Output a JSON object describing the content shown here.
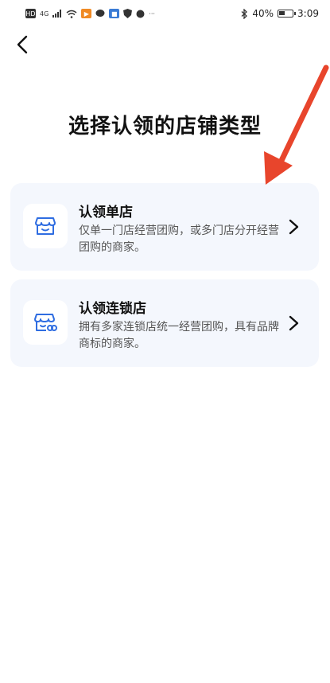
{
  "status_bar": {
    "network_label": "4G",
    "battery_percent": "40%",
    "time": "3:09",
    "more_indicator": "···",
    "icons": [
      "hd-icon",
      "signal-icon",
      "wifi-icon",
      "app-notification-icon",
      "chat-icon",
      "app-icon",
      "shield-icon",
      "bluetooth-icon",
      "battery-icon"
    ]
  },
  "header": {
    "back_icon": "chevron-left-icon",
    "title": "选择认领的店铺类型"
  },
  "options": [
    {
      "title": "认领单店",
      "description": "仅单一门店经营团购，或多门店分开经营团购的商家。",
      "icon": "single-store-icon"
    },
    {
      "title": "认领连锁店",
      "description": "拥有多家连锁店统一经营团购，具有品牌商标的商家。",
      "icon": "chain-store-icon"
    }
  ],
  "colors": {
    "card_bg": "#f4f7fd",
    "icon_blue": "#2f6de1",
    "annotation_red": "#e8452c"
  }
}
